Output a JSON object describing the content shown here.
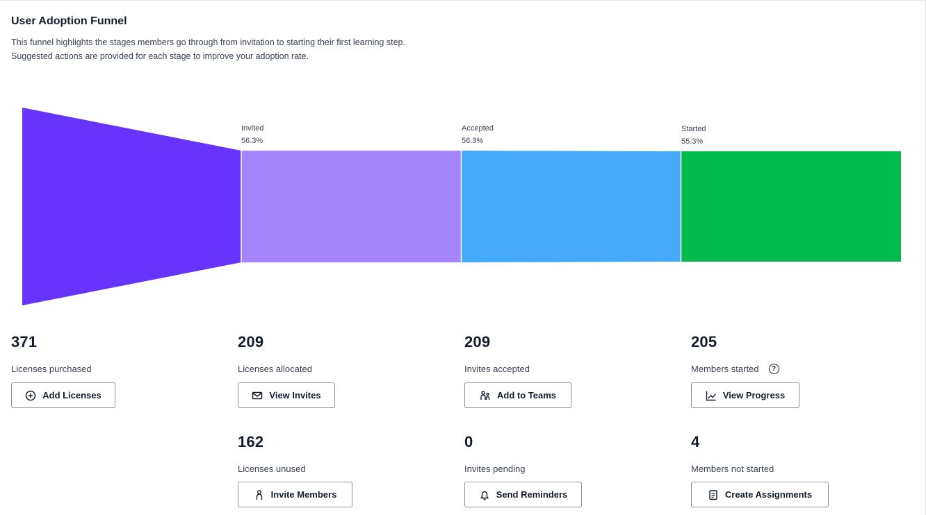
{
  "header": {
    "title": "User Adoption Funnel",
    "description_line1": "This funnel highlights the stages members go through from invitation to starting their first learning step.",
    "description_line2": "Suggested actions are provided for each stage to improve your adoption rate."
  },
  "funnel": {
    "stages": [
      {
        "name": "",
        "percent": "",
        "color": "#6633ff"
      },
      {
        "name": "Invited",
        "percent": "56.3%",
        "color": "#a585fb"
      },
      {
        "name": "Accepted",
        "percent": "56.3%",
        "color": "#45a9fc"
      },
      {
        "name": "Started",
        "percent": "55.3%",
        "color": "#02bb4c"
      }
    ]
  },
  "metrics": {
    "purchased": {
      "value": "371",
      "label": "Licenses purchased",
      "button": "Add Licenses",
      "icon": "plus-circle-icon"
    },
    "allocated": {
      "value": "209",
      "label": "Licenses allocated",
      "button": "View Invites",
      "icon": "envelope-icon"
    },
    "accepted": {
      "value": "209",
      "label": "Invites accepted",
      "button": "Add to Teams",
      "icon": "team-icon"
    },
    "started": {
      "value": "205",
      "label": "Members started",
      "button": "View Progress",
      "icon": "chart-line-icon",
      "help_icon": "?"
    },
    "unused": {
      "value": "162",
      "label": "Licenses unused",
      "button": "Invite Members",
      "icon": "person-icon"
    },
    "pending": {
      "value": "0",
      "label": "Invites pending",
      "button": "Send Reminders",
      "icon": "bell-icon"
    },
    "not_started": {
      "value": "4",
      "label": "Members not started",
      "button": "Create Assignments",
      "icon": "clipboard-icon"
    }
  }
}
